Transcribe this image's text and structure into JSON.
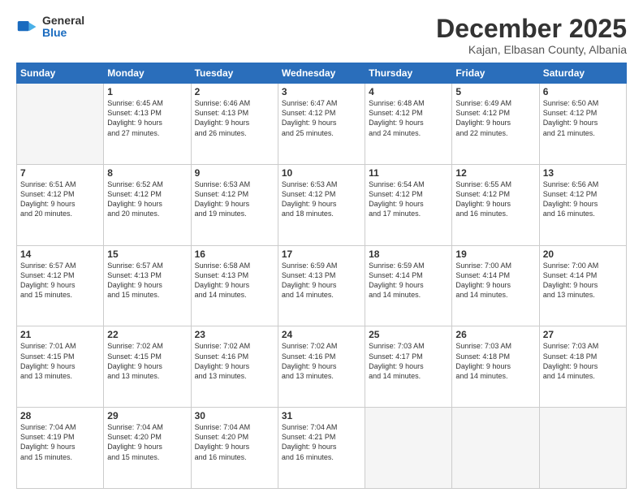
{
  "logo": {
    "general": "General",
    "blue": "Blue"
  },
  "header": {
    "month": "December 2025",
    "location": "Kajan, Elbasan County, Albania"
  },
  "weekdays": [
    "Sunday",
    "Monday",
    "Tuesday",
    "Wednesday",
    "Thursday",
    "Friday",
    "Saturday"
  ],
  "weeks": [
    [
      {
        "day": "",
        "info": ""
      },
      {
        "day": "1",
        "info": "Sunrise: 6:45 AM\nSunset: 4:13 PM\nDaylight: 9 hours\nand 27 minutes."
      },
      {
        "day": "2",
        "info": "Sunrise: 6:46 AM\nSunset: 4:13 PM\nDaylight: 9 hours\nand 26 minutes."
      },
      {
        "day": "3",
        "info": "Sunrise: 6:47 AM\nSunset: 4:12 PM\nDaylight: 9 hours\nand 25 minutes."
      },
      {
        "day": "4",
        "info": "Sunrise: 6:48 AM\nSunset: 4:12 PM\nDaylight: 9 hours\nand 24 minutes."
      },
      {
        "day": "5",
        "info": "Sunrise: 6:49 AM\nSunset: 4:12 PM\nDaylight: 9 hours\nand 22 minutes."
      },
      {
        "day": "6",
        "info": "Sunrise: 6:50 AM\nSunset: 4:12 PM\nDaylight: 9 hours\nand 21 minutes."
      }
    ],
    [
      {
        "day": "7",
        "info": "Sunrise: 6:51 AM\nSunset: 4:12 PM\nDaylight: 9 hours\nand 20 minutes."
      },
      {
        "day": "8",
        "info": "Sunrise: 6:52 AM\nSunset: 4:12 PM\nDaylight: 9 hours\nand 20 minutes."
      },
      {
        "day": "9",
        "info": "Sunrise: 6:53 AM\nSunset: 4:12 PM\nDaylight: 9 hours\nand 19 minutes."
      },
      {
        "day": "10",
        "info": "Sunrise: 6:53 AM\nSunset: 4:12 PM\nDaylight: 9 hours\nand 18 minutes."
      },
      {
        "day": "11",
        "info": "Sunrise: 6:54 AM\nSunset: 4:12 PM\nDaylight: 9 hours\nand 17 minutes."
      },
      {
        "day": "12",
        "info": "Sunrise: 6:55 AM\nSunset: 4:12 PM\nDaylight: 9 hours\nand 16 minutes."
      },
      {
        "day": "13",
        "info": "Sunrise: 6:56 AM\nSunset: 4:12 PM\nDaylight: 9 hours\nand 16 minutes."
      }
    ],
    [
      {
        "day": "14",
        "info": "Sunrise: 6:57 AM\nSunset: 4:12 PM\nDaylight: 9 hours\nand 15 minutes."
      },
      {
        "day": "15",
        "info": "Sunrise: 6:57 AM\nSunset: 4:13 PM\nDaylight: 9 hours\nand 15 minutes."
      },
      {
        "day": "16",
        "info": "Sunrise: 6:58 AM\nSunset: 4:13 PM\nDaylight: 9 hours\nand 14 minutes."
      },
      {
        "day": "17",
        "info": "Sunrise: 6:59 AM\nSunset: 4:13 PM\nDaylight: 9 hours\nand 14 minutes."
      },
      {
        "day": "18",
        "info": "Sunrise: 6:59 AM\nSunset: 4:14 PM\nDaylight: 9 hours\nand 14 minutes."
      },
      {
        "day": "19",
        "info": "Sunrise: 7:00 AM\nSunset: 4:14 PM\nDaylight: 9 hours\nand 14 minutes."
      },
      {
        "day": "20",
        "info": "Sunrise: 7:00 AM\nSunset: 4:14 PM\nDaylight: 9 hours\nand 13 minutes."
      }
    ],
    [
      {
        "day": "21",
        "info": "Sunrise: 7:01 AM\nSunset: 4:15 PM\nDaylight: 9 hours\nand 13 minutes."
      },
      {
        "day": "22",
        "info": "Sunrise: 7:02 AM\nSunset: 4:15 PM\nDaylight: 9 hours\nand 13 minutes."
      },
      {
        "day": "23",
        "info": "Sunrise: 7:02 AM\nSunset: 4:16 PM\nDaylight: 9 hours\nand 13 minutes."
      },
      {
        "day": "24",
        "info": "Sunrise: 7:02 AM\nSunset: 4:16 PM\nDaylight: 9 hours\nand 13 minutes."
      },
      {
        "day": "25",
        "info": "Sunrise: 7:03 AM\nSunset: 4:17 PM\nDaylight: 9 hours\nand 14 minutes."
      },
      {
        "day": "26",
        "info": "Sunrise: 7:03 AM\nSunset: 4:18 PM\nDaylight: 9 hours\nand 14 minutes."
      },
      {
        "day": "27",
        "info": "Sunrise: 7:03 AM\nSunset: 4:18 PM\nDaylight: 9 hours\nand 14 minutes."
      }
    ],
    [
      {
        "day": "28",
        "info": "Sunrise: 7:04 AM\nSunset: 4:19 PM\nDaylight: 9 hours\nand 15 minutes."
      },
      {
        "day": "29",
        "info": "Sunrise: 7:04 AM\nSunset: 4:20 PM\nDaylight: 9 hours\nand 15 minutes."
      },
      {
        "day": "30",
        "info": "Sunrise: 7:04 AM\nSunset: 4:20 PM\nDaylight: 9 hours\nand 16 minutes."
      },
      {
        "day": "31",
        "info": "Sunrise: 7:04 AM\nSunset: 4:21 PM\nDaylight: 9 hours\nand 16 minutes."
      },
      {
        "day": "",
        "info": ""
      },
      {
        "day": "",
        "info": ""
      },
      {
        "day": "",
        "info": ""
      }
    ]
  ]
}
